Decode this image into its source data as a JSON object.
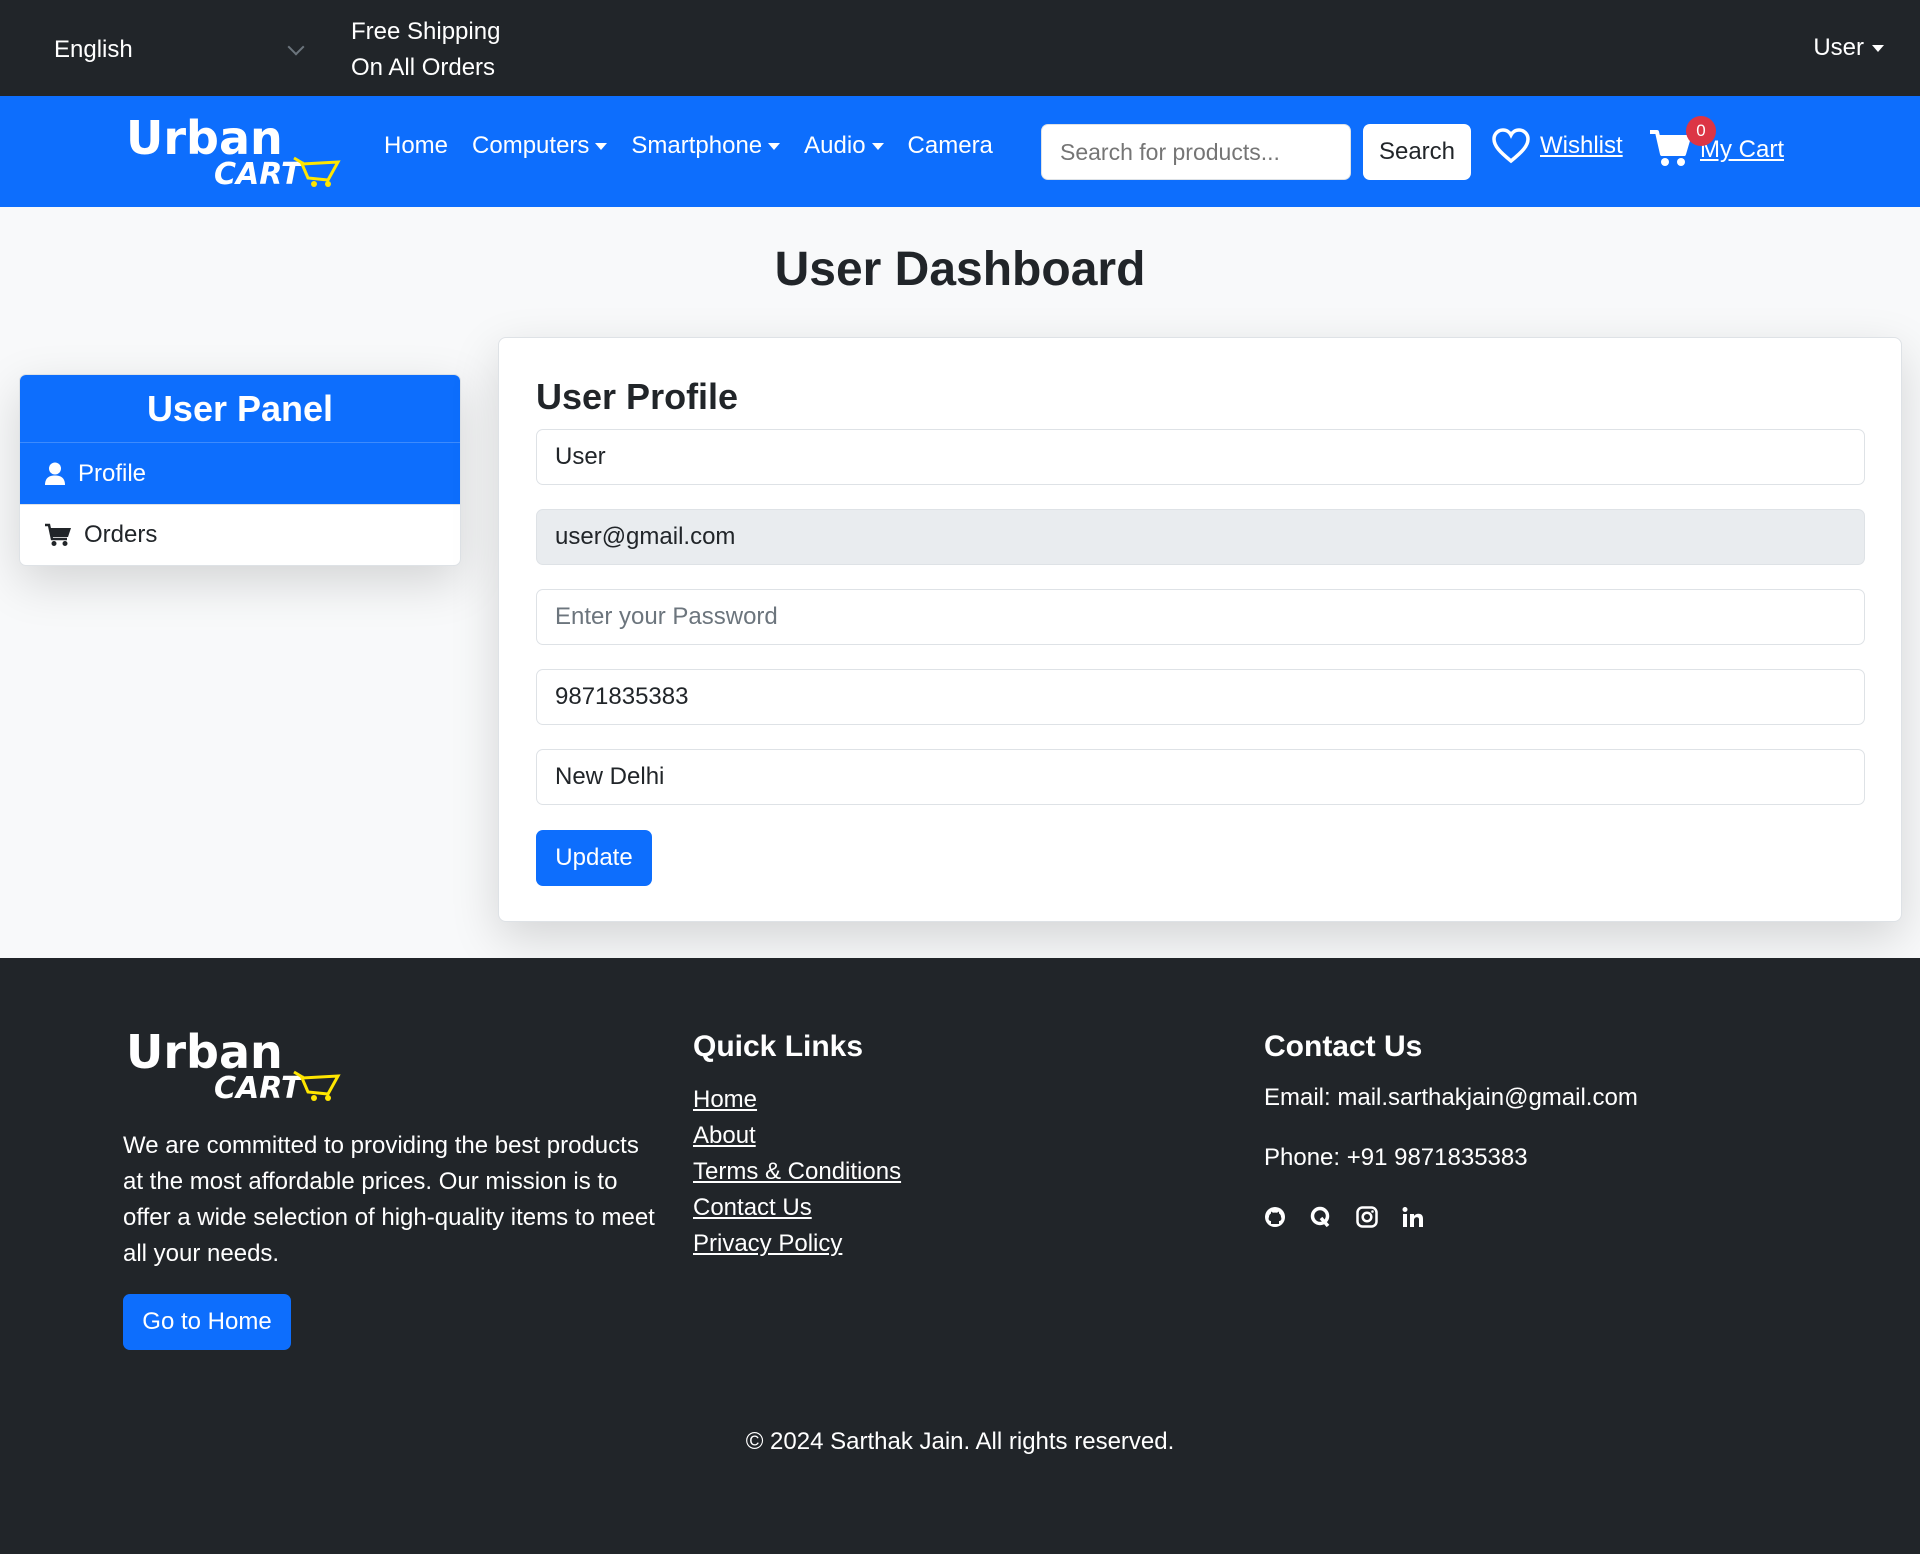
{
  "topbar": {
    "language": "English",
    "promo_line1": "Free Shipping",
    "promo_line2": "On All Orders",
    "user_menu": "User"
  },
  "navbar": {
    "logo_text": "Urban",
    "logo_subtext": "CART",
    "links": [
      "Home",
      "Computers",
      "Smartphone",
      "Audio",
      "Camera"
    ],
    "search_placeholder": "Search for products...",
    "search_button": "Search",
    "wishlist": "Wishlist",
    "cart": "My Cart",
    "cart_count": "0"
  },
  "main": {
    "title": "User Dashboard",
    "panel": {
      "title": "User Panel",
      "items": [
        "Profile",
        "Orders"
      ]
    },
    "profile": {
      "title": "User Profile",
      "name": "User",
      "email": "user@gmail.com",
      "password_placeholder": "Enter your Password",
      "phone": "9871835383",
      "city": "New Delhi",
      "update_button": "Update"
    }
  },
  "footer": {
    "about": "We are committed to providing the best products at the most affordable prices. Our mission is to offer a wide selection of high-quality items to meet all your needs.",
    "home_button": "Go to Home",
    "quick_links_title": "Quick Links",
    "quick_links": [
      "Home",
      "About",
      "Terms & Conditions",
      "Contact Us",
      "Privacy Policy"
    ],
    "contact_title": "Contact Us",
    "email": "Email: mail.sarthakjain@gmail.com",
    "phone": "Phone: +91 9871835383",
    "socials": [
      "github-icon",
      "quora-icon",
      "instagram-icon",
      "linkedin-icon"
    ],
    "copyright": "© 2024 Sarthak Jain. All rights reserved."
  },
  "colors": {
    "primary": "#0d6efd",
    "dark": "#212529",
    "badge": "#dc3545",
    "logo_accent": "#ffe600"
  }
}
